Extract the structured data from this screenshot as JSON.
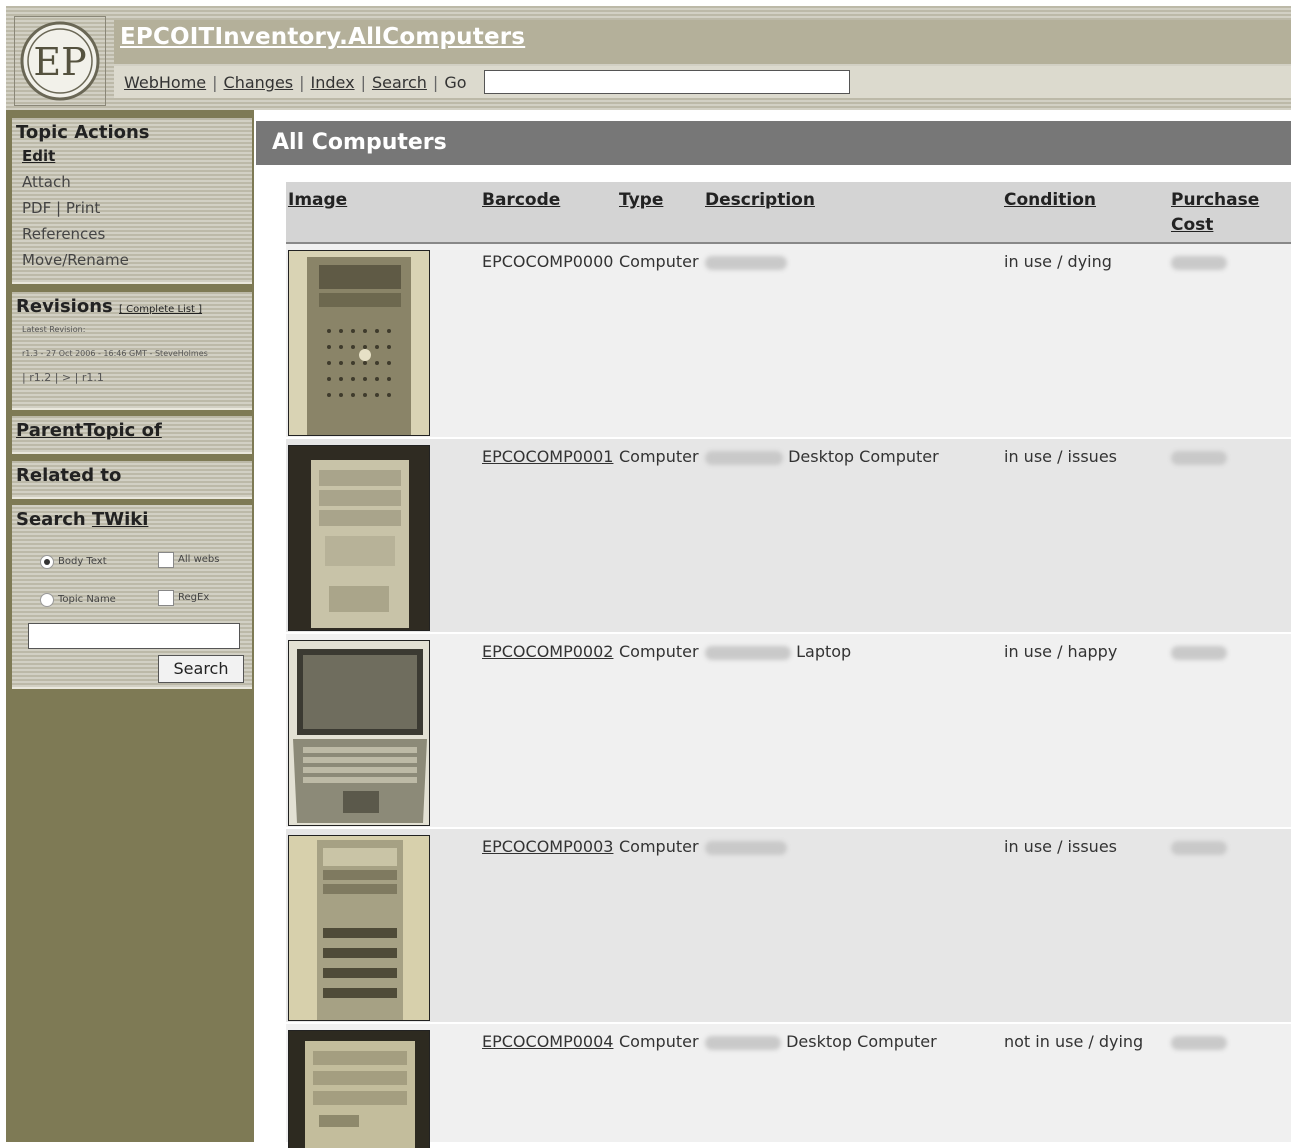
{
  "header": {
    "web_title": "EPCOITInventory.AllComputers",
    "nav": [
      "WebHome",
      "Changes",
      "Index",
      "Search",
      "Go"
    ],
    "logo_letters": "EP"
  },
  "sidebar": {
    "topic_actions": {
      "title": "Topic Actions",
      "items": [
        "Edit",
        "Attach",
        "PDF | Print",
        "References",
        "Move/Rename"
      ]
    },
    "revisions": {
      "title": "Revisions",
      "complete_list": "[ Complete List ]",
      "latest_label": "Latest Revision:",
      "latest_value": "r1.3 - 27 Oct 2006 - 16:46 GMT - SteveHolmes",
      "history": "| r1.2 | > | r1.1"
    },
    "parent_topic": "ParentTopic of",
    "related_to": "Related to",
    "search": {
      "title_prefix": "Search ",
      "title_link": "TWiki",
      "opt_body_text": "Body Text",
      "opt_all_webs": "All webs",
      "opt_topic_name": "Topic Name",
      "opt_regex": "RegEx",
      "button": "Search"
    }
  },
  "main": {
    "topic_title": "All Computers",
    "columns": [
      "Image",
      "Barcode",
      "Type",
      "Description",
      "Condition",
      "Purchase",
      "Cost"
    ],
    "rows": [
      {
        "barcode": "EPCOCOMP0000",
        "type": "Computer",
        "description": "",
        "condition": "in use / dying"
      },
      {
        "barcode": "EPCOCOMP0001",
        "type": "Computer",
        "description": "Desktop Computer",
        "condition": "in use / issues"
      },
      {
        "barcode": "EPCOCOMP0002",
        "type": "Computer",
        "description": "Laptop",
        "condition": "in use / happy"
      },
      {
        "barcode": "EPCOCOMP0003",
        "type": "Computer",
        "description": "",
        "condition": "in use / issues"
      },
      {
        "barcode": "EPCOCOMP0004",
        "type": "Computer",
        "description": "Desktop Computer",
        "condition": "not in use / dying"
      }
    ]
  }
}
